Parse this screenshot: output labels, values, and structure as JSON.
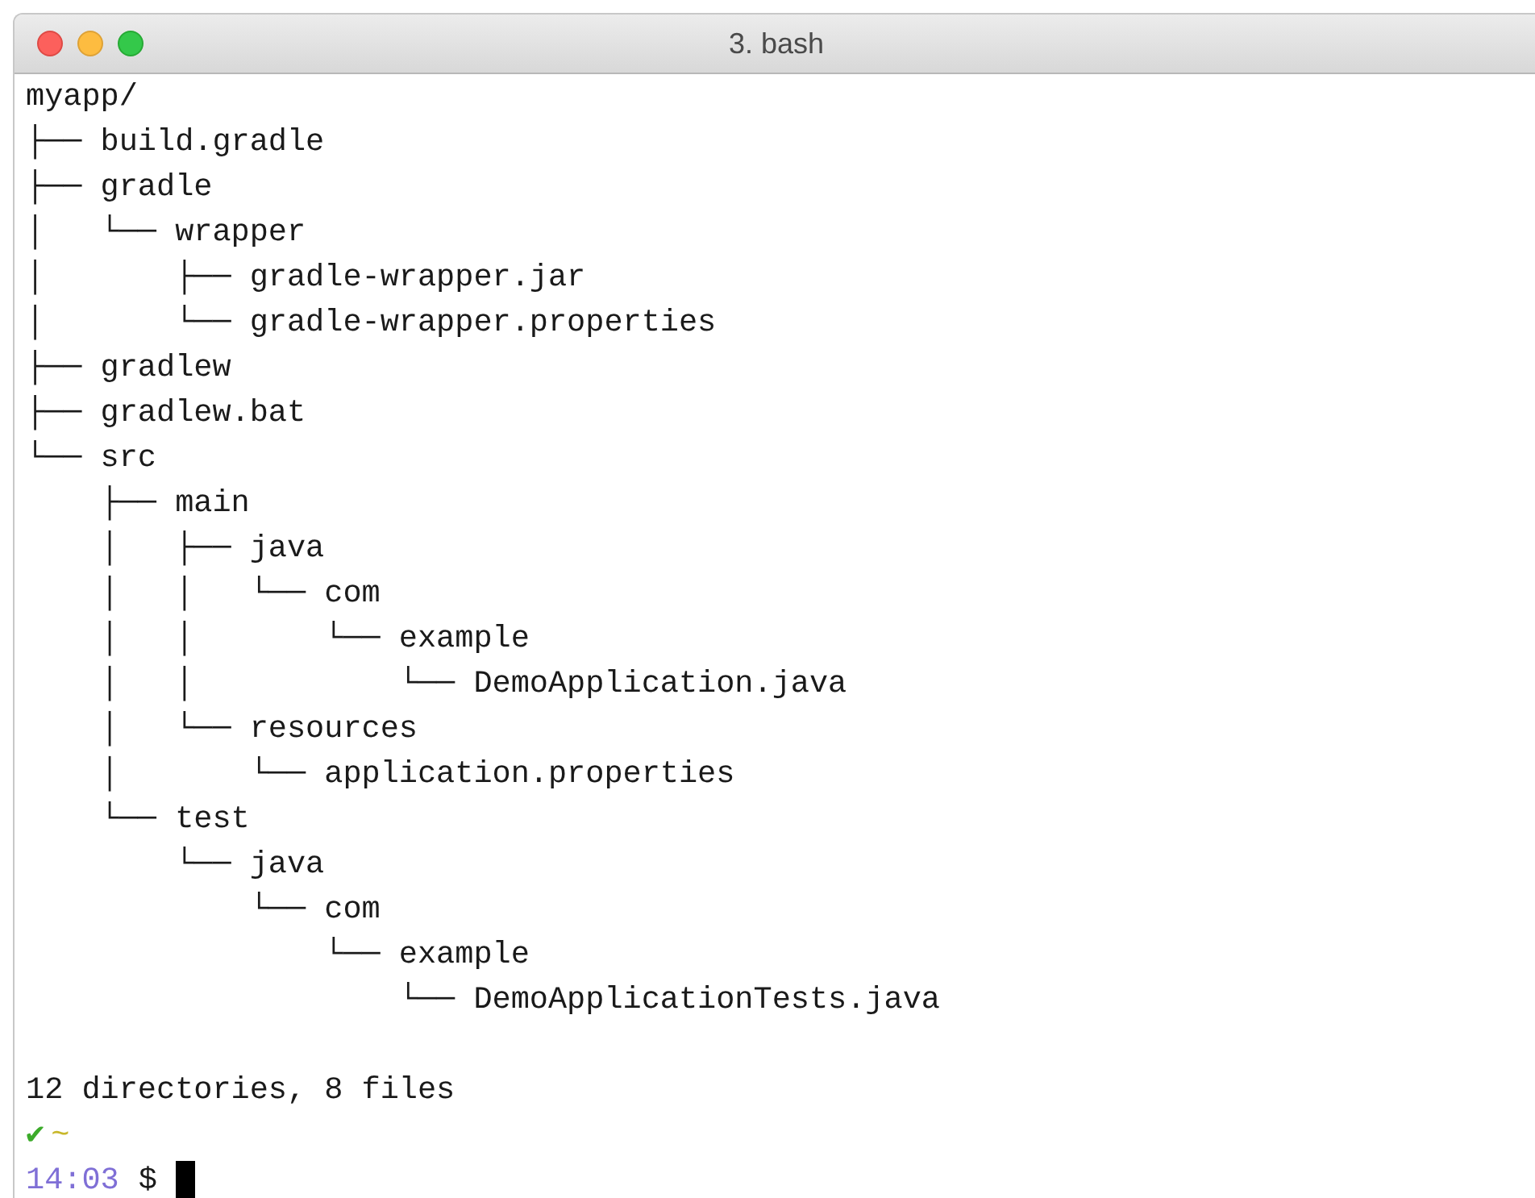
{
  "window": {
    "title": "3. bash"
  },
  "output_lines": [
    "myapp/",
    "├── build.gradle",
    "├── gradle",
    "│   └── wrapper",
    "│       ├── gradle-wrapper.jar",
    "│       └── gradle-wrapper.properties",
    "├── gradlew",
    "├── gradlew.bat",
    "└── src",
    "    ├── main",
    "    │   ├── java",
    "    │   │   └── com",
    "    │   │       └── example",
    "    │   │           └── DemoApplication.java",
    "    │   └── resources",
    "    │       └── application.properties",
    "    └── test",
    "        └── java",
    "            └── com",
    "                └── example",
    "                    └── DemoApplicationTests.java"
  ],
  "summary": "12 directories, 8 files",
  "status": {
    "check": "✔",
    "directory": "~"
  },
  "prompt": {
    "time": "14:03",
    "symbol": "$"
  }
}
